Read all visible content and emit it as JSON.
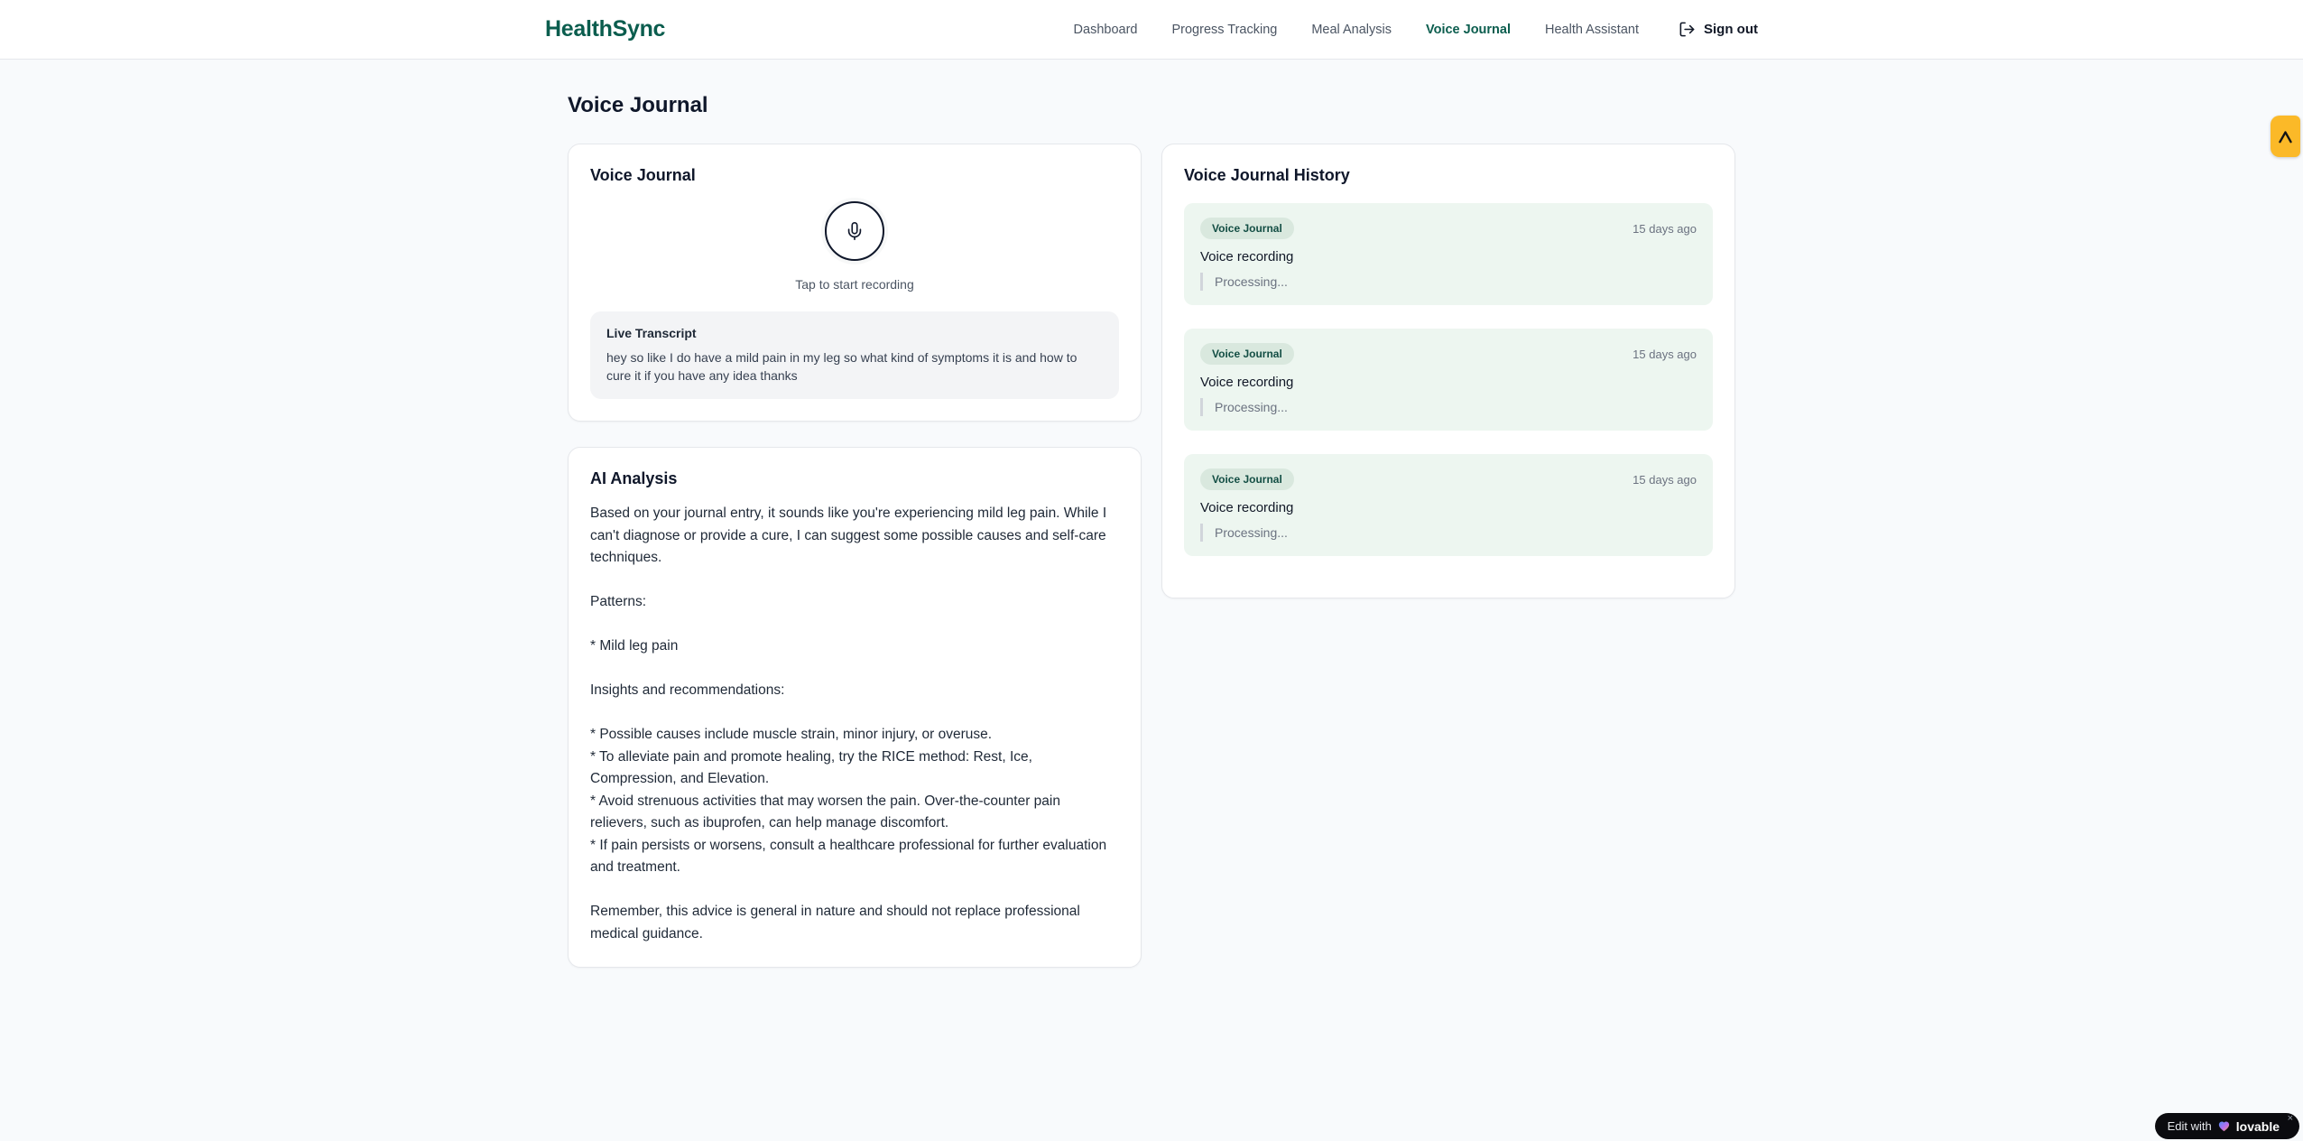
{
  "brand": {
    "name": "HealthSync"
  },
  "nav": {
    "items": [
      {
        "label": "Dashboard",
        "active": false
      },
      {
        "label": "Progress Tracking",
        "active": false
      },
      {
        "label": "Meal Analysis",
        "active": false
      },
      {
        "label": "Voice Journal",
        "active": true
      },
      {
        "label": "Health Assistant",
        "active": false
      }
    ],
    "sign_out_label": "Sign out"
  },
  "page": {
    "title": "Voice Journal"
  },
  "recorder": {
    "title": "Voice Journal",
    "tap_hint": "Tap to start recording",
    "transcript_title": "Live Transcript",
    "transcript_text": "hey so like I do have a mild pain in my leg so what kind of symptoms it is and how to cure it if you have any idea thanks"
  },
  "analysis": {
    "title": "AI Analysis",
    "body": "Based on your journal entry, it sounds like you're experiencing mild leg pain. While I can't diagnose or provide a cure, I can suggest some possible causes and self-care techniques.\n\nPatterns:\n\n* Mild leg pain\n\nInsights and recommendations:\n\n* Possible causes include muscle strain, minor injury, or overuse.\n* To alleviate pain and promote healing, try the RICE method: Rest, Ice, Compression, and Elevation.\n* Avoid strenuous activities that may worsen the pain. Over-the-counter pain relievers, such as ibuprofen, can help manage discomfort.\n* If pain persists or worsens, consult a healthcare professional for further evaluation and treatment.\n\nRemember, this advice is general in nature and should not replace professional medical guidance."
  },
  "history": {
    "title": "Voice Journal History",
    "entries": [
      {
        "badge": "Voice Journal",
        "time": "15 days ago",
        "label": "Voice recording",
        "status": "Processing..."
      },
      {
        "badge": "Voice Journal",
        "time": "15 days ago",
        "label": "Voice recording",
        "status": "Processing..."
      },
      {
        "badge": "Voice Journal",
        "time": "15 days ago",
        "label": "Voice recording",
        "status": "Processing..."
      }
    ]
  },
  "badges": {
    "edit_with": "Edit with",
    "brand": "lovable",
    "close": "×"
  },
  "colors": {
    "brand_teal": "#0b5d4e",
    "entry_bg_green": "#edf6f0",
    "badge_bg_green": "#d9e8de",
    "badge_text_teal": "#134e44",
    "side_badge_amber": "#fbb928",
    "pill_black": "#0b0b0f",
    "page_bg": "#f8fafc",
    "card_border": "#e5e7eb"
  }
}
